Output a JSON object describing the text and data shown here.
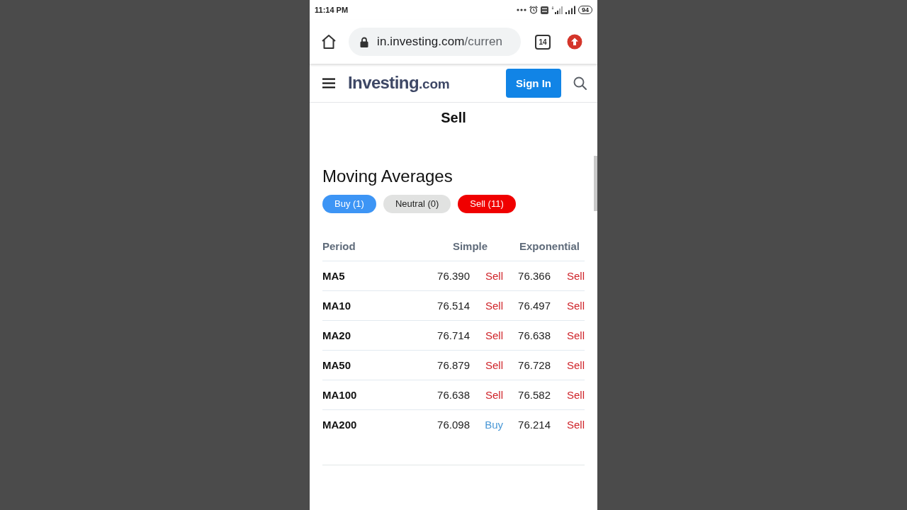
{
  "status_bar": {
    "time": "11:14 PM",
    "battery": "94"
  },
  "browser": {
    "url_host": "in.investing.com",
    "url_path": "/curren",
    "tab_count": "14"
  },
  "site_header": {
    "logo": {
      "name": "Investing",
      "suffix": ".com"
    },
    "sign_in": "Sign In"
  },
  "summary": {
    "label": "Sell"
  },
  "moving_averages": {
    "title": "Moving Averages",
    "counts": [
      {
        "kind": "buy",
        "label": "Buy (1)"
      },
      {
        "kind": "neutral",
        "label": "Neutral (0)"
      },
      {
        "kind": "sell",
        "label": "Sell (11)"
      }
    ],
    "table": {
      "columns": [
        "Period",
        "Simple",
        "Exponential"
      ],
      "rows": [
        {
          "period": "MA5",
          "simple": {
            "value": "76.390",
            "signal": "Sell",
            "kind": "sell"
          },
          "exponential": {
            "value": "76.366",
            "signal": "Sell",
            "kind": "sell"
          }
        },
        {
          "period": "MA10",
          "simple": {
            "value": "76.514",
            "signal": "Sell",
            "kind": "sell"
          },
          "exponential": {
            "value": "76.497",
            "signal": "Sell",
            "kind": "sell"
          }
        },
        {
          "period": "MA20",
          "simple": {
            "value": "76.714",
            "signal": "Sell",
            "kind": "sell"
          },
          "exponential": {
            "value": "76.638",
            "signal": "Sell",
            "kind": "sell"
          }
        },
        {
          "period": "MA50",
          "simple": {
            "value": "76.879",
            "signal": "Sell",
            "kind": "sell"
          },
          "exponential": {
            "value": "76.728",
            "signal": "Sell",
            "kind": "sell"
          }
        },
        {
          "period": "MA100",
          "simple": {
            "value": "76.638",
            "signal": "Sell",
            "kind": "sell"
          },
          "exponential": {
            "value": "76.582",
            "signal": "Sell",
            "kind": "sell"
          }
        },
        {
          "period": "MA200",
          "simple": {
            "value": "76.098",
            "signal": "Buy",
            "kind": "buy"
          },
          "exponential": {
            "value": "76.214",
            "signal": "Sell",
            "kind": "sell"
          }
        }
      ]
    }
  }
}
